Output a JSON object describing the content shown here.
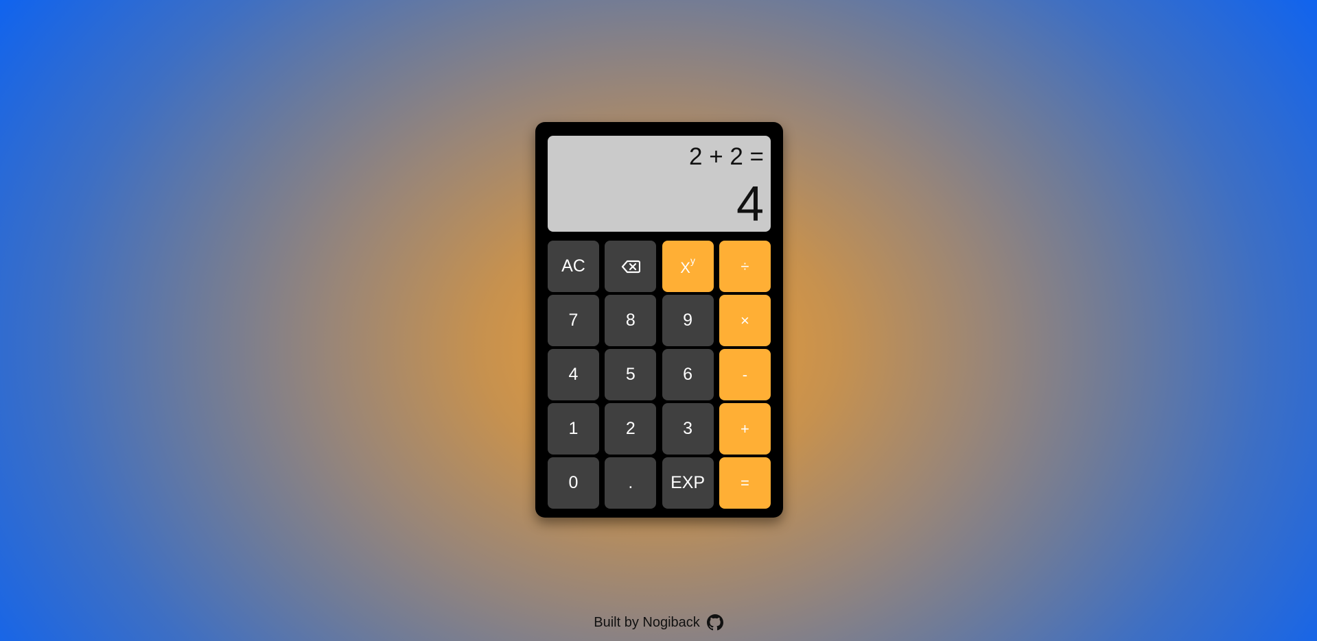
{
  "display": {
    "expression": "2 + 2 =",
    "result": "4"
  },
  "keys": [
    {
      "label": "AC",
      "name": "all-clear-button",
      "type": "func"
    },
    {
      "icon": "backspace-icon",
      "name": "backspace-button",
      "type": "func"
    },
    {
      "base": "X",
      "exp": "y",
      "name": "power-button",
      "type": "op"
    },
    {
      "label": "÷",
      "name": "divide-button",
      "type": "op"
    },
    {
      "label": "7",
      "name": "digit-7-button",
      "type": "num"
    },
    {
      "label": "8",
      "name": "digit-8-button",
      "type": "num"
    },
    {
      "label": "9",
      "name": "digit-9-button",
      "type": "num"
    },
    {
      "label": "×",
      "name": "multiply-button",
      "type": "op"
    },
    {
      "label": "4",
      "name": "digit-4-button",
      "type": "num"
    },
    {
      "label": "5",
      "name": "digit-5-button",
      "type": "num"
    },
    {
      "label": "6",
      "name": "digit-6-button",
      "type": "num"
    },
    {
      "label": "-",
      "name": "subtract-button",
      "type": "op"
    },
    {
      "label": "1",
      "name": "digit-1-button",
      "type": "num"
    },
    {
      "label": "2",
      "name": "digit-2-button",
      "type": "num"
    },
    {
      "label": "3",
      "name": "digit-3-button",
      "type": "num"
    },
    {
      "label": "+",
      "name": "add-button",
      "type": "op"
    },
    {
      "label": "0",
      "name": "digit-0-button",
      "type": "num"
    },
    {
      "label": ".",
      "name": "decimal-button",
      "type": "num"
    },
    {
      "label": "EXP",
      "name": "exp-button",
      "type": "num"
    },
    {
      "label": "=",
      "name": "equals-button",
      "type": "op"
    }
  ],
  "footer": {
    "text": "Built by Nogiback",
    "icon": "github-icon"
  },
  "colors": {
    "operator_key": "#ffaf35",
    "number_key": "#404040",
    "display_bg": "#cacaca",
    "body": "#000000"
  }
}
